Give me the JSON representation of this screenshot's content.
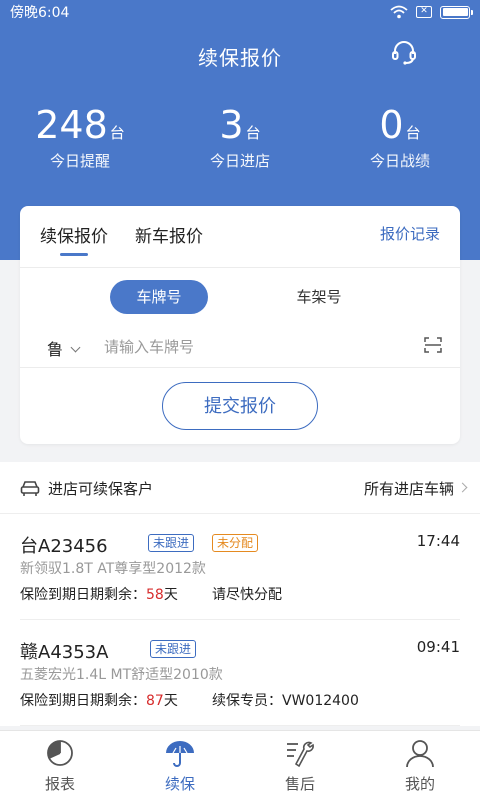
{
  "status": {
    "time": "傍晚6:04",
    "sim_label": "✕",
    "battery_level": 1.0
  },
  "header": {
    "title": "续保报价",
    "headset_icon": "headset-icon"
  },
  "stats": [
    {
      "value": "248",
      "unit": "台",
      "label": "今日提醒"
    },
    {
      "value": "3",
      "unit": "台",
      "label": "今日进店"
    },
    {
      "value": "0",
      "unit": "台",
      "label": "今日战绩"
    }
  ],
  "quote": {
    "tab_renewal": "续保报价",
    "tab_newcar": "新车报价",
    "records_link": "报价记录",
    "seg_plate": "车牌号",
    "seg_vin": "车架号",
    "province": "鲁",
    "plate_placeholder": "请输入车牌号",
    "plate_value": "",
    "submit": "提交报价"
  },
  "list_header": {
    "title": "进店可续保客户",
    "link": "所有进店车辆"
  },
  "customers": [
    {
      "plate": "台A23456",
      "tags": [
        "未跟进",
        "未分配"
      ],
      "time": "17:44",
      "model": "新领驭1.8T AT尊享型2012款",
      "expire_prefix": "保险到期日期剩余：",
      "days": "58",
      "days_unit": "天",
      "note": "请尽快分配"
    },
    {
      "plate": "赣A4353A",
      "tags": [
        "未跟进"
      ],
      "time": "09:41",
      "model": "五菱宏光1.4L MT舒适型2010款",
      "expire_prefix": "保险到期日期剩余：",
      "days": "87",
      "days_unit": "天",
      "note": "续保专员：VW012400"
    }
  ],
  "tabbar": [
    {
      "label": "报表",
      "icon": "report-icon"
    },
    {
      "label": "续保",
      "icon": "umbrella-icon",
      "active": true
    },
    {
      "label": "售后",
      "icon": "wrench-icon"
    },
    {
      "label": "我的",
      "icon": "user-icon"
    }
  ],
  "colors": {
    "primary": "#4a78c9",
    "link": "#3d6cc0",
    "danger": "#d72c2c",
    "warning": "#e58a20"
  }
}
